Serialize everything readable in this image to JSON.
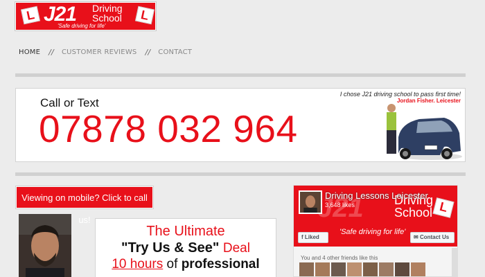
{
  "logo": {
    "brand": "J21",
    "school_line1": "Driving",
    "school_line2": "School",
    "tagline": "'Safe driving for life'",
    "plate_letter": "L"
  },
  "nav": {
    "items": [
      {
        "label": "Home",
        "active": true
      },
      {
        "label": "Customer Reviews",
        "active": false
      },
      {
        "label": "Contact",
        "active": false
      }
    ],
    "separator": "//"
  },
  "banner": {
    "call_label": "Call or Text",
    "phone": "07878 032 964",
    "quote": "I chose J21 driving school to pass first time!",
    "quote_by": "Jordan Fisher, Leicester"
  },
  "mobile_button": {
    "label": "Viewing on mobile? Click to call us!"
  },
  "deal": {
    "line1": "The Ultimate",
    "line2_bold": "\"Try Us & See\"",
    "line2_red": "Deal",
    "line3_hours": "10 hours",
    "line3_of": "of",
    "line3_professional": "professional"
  },
  "facebook": {
    "page_name": "Driving Lessons Leicester",
    "likes": "3,648 likes",
    "cover_brand": "J21",
    "cover_school_line1": "Driving",
    "cover_school_line2": "School",
    "cover_tagline": "'Safe driving for life'",
    "liked_label": "Liked",
    "contact_label": "Contact Us",
    "friends_text": "You and 4 other friends like this"
  },
  "colors": {
    "brand_red": "#e8101a",
    "background": "#ececec"
  }
}
